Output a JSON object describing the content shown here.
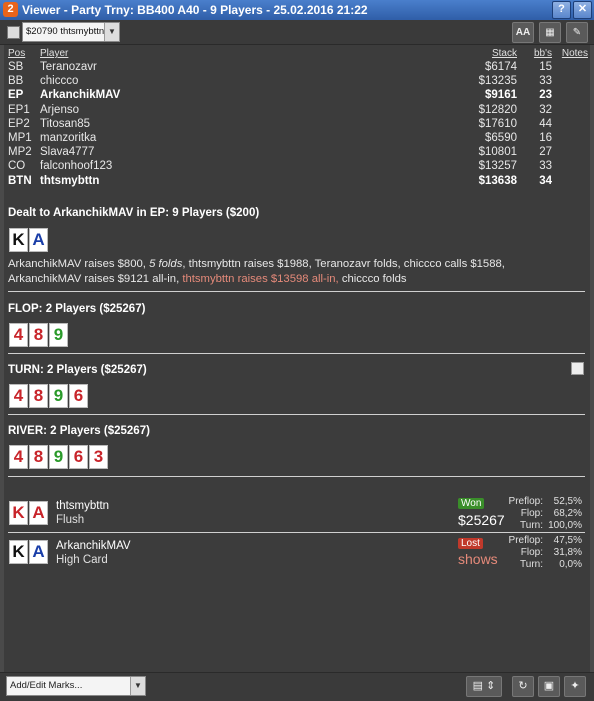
{
  "window": {
    "logo": "2",
    "title": "Viewer - Party Trny: BB400 A40 - 9 Players - 25.02.2016 21:22",
    "icons": [
      "help-icon",
      "close-icon"
    ]
  },
  "toolbar": {
    "player_select": "$20790 thtsmybttn",
    "font_button": "AA",
    "icons": [
      "grid-icon",
      "pencil-icon"
    ]
  },
  "players": {
    "headers": {
      "pos": "Pos",
      "player": "Player",
      "stack": "Stack",
      "bbs": "bb's",
      "notes": "Notes"
    },
    "rows": [
      {
        "pos": "SB",
        "name": "Teranozavr",
        "stack": "$6174",
        "bbs": "15"
      },
      {
        "pos": "BB",
        "name": "chiccco",
        "stack": "$13235",
        "bbs": "33"
      },
      {
        "pos": "EP",
        "name": "ArkanchikMAV",
        "stack": "$9161",
        "bbs": "23"
      },
      {
        "pos": "EP1",
        "name": "Arjenso",
        "stack": "$12820",
        "bbs": "32"
      },
      {
        "pos": "EP2",
        "name": "Titosan85",
        "stack": "$17610",
        "bbs": "44"
      },
      {
        "pos": "MP1",
        "name": "manzoritka",
        "stack": "$6590",
        "bbs": "16"
      },
      {
        "pos": "MP2",
        "name": "Slava4777",
        "stack": "$10801",
        "bbs": "27"
      },
      {
        "pos": "CO",
        "name": "falconhoof123",
        "stack": "$13257",
        "bbs": "33"
      },
      {
        "pos": "BTN",
        "name": "thtsmybttn",
        "stack": "$13638",
        "bbs": "34"
      }
    ]
  },
  "preflop": {
    "title": "Dealt to ArkanchikMAV in EP: 9 Players ($200)",
    "cards": [
      {
        "rank": "K",
        "color": "black"
      },
      {
        "rank": "A",
        "color": "blue"
      }
    ],
    "action_1": "ArkanchikMAV raises $800, ",
    "action_folds": "5 folds",
    "action_2": ", thtsmybttn raises $1988, Teranozavr folds, chiccco calls $1588, ArkanchikMAV raises $9121 all-in, ",
    "action_hl": "thtsmybttn raises $13598 all-in,",
    "action_3": " chiccco folds"
  },
  "flop": {
    "title": "FLOP: 2 Players ($25267)",
    "cards": [
      {
        "rank": "4",
        "color": "red"
      },
      {
        "rank": "8",
        "color": "red"
      },
      {
        "rank": "9",
        "color": "green"
      }
    ]
  },
  "turn": {
    "title": "TURN: 2 Players ($25267)",
    "cards": [
      {
        "rank": "4",
        "color": "red"
      },
      {
        "rank": "8",
        "color": "red"
      },
      {
        "rank": "9",
        "color": "green"
      },
      {
        "rank": "6",
        "color": "red"
      }
    ]
  },
  "river": {
    "title": "RIVER: 2 Players ($25267)",
    "cards": [
      {
        "rank": "4",
        "color": "red"
      },
      {
        "rank": "8",
        "color": "red"
      },
      {
        "rank": "9",
        "color": "green"
      },
      {
        "rank": "6",
        "color": "red"
      },
      {
        "rank": "3",
        "color": "red"
      }
    ]
  },
  "results": [
    {
      "name": "thtsmybttn",
      "hand": "Flush",
      "cards": [
        {
          "rank": "K",
          "color": "red"
        },
        {
          "rank": "A",
          "color": "red"
        }
      ],
      "badge": "Won",
      "amount": "$25267",
      "equity": [
        {
          "label": "Preflop:",
          "value": "52,5%"
        },
        {
          "label": "Flop:",
          "value": "68,2%"
        },
        {
          "label": "Turn:",
          "value": "100,0%"
        }
      ]
    },
    {
      "name": "ArkanchikMAV",
      "hand": "High Card",
      "cards": [
        {
          "rank": "K",
          "color": "black"
        },
        {
          "rank": "A",
          "color": "blue"
        }
      ],
      "badge": "Lost",
      "amount": "shows",
      "equity": [
        {
          "label": "Preflop:",
          "value": "47,5%"
        },
        {
          "label": "Flop:",
          "value": "31,8%"
        },
        {
          "label": "Turn:",
          "value": "0,0%"
        }
      ]
    }
  ],
  "bottom": {
    "marks_label": "Add/Edit Marks...",
    "icons": [
      "clipboard-icon",
      "refresh-icon",
      "save-icon",
      "twitter-icon"
    ]
  },
  "colors": {
    "titlebar": "#3a6cba",
    "background": "#3c3c3c",
    "won": "#3a8e2a",
    "lost": "#c0392b",
    "highlight": "#e58a7a"
  }
}
